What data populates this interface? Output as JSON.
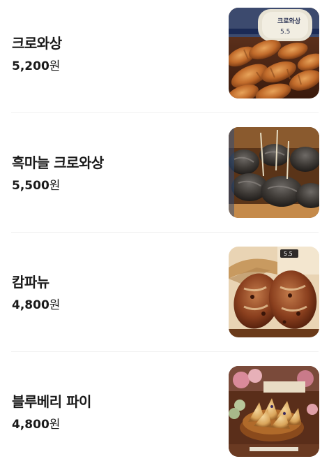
{
  "menu": {
    "items": [
      {
        "name": "크로와상",
        "price": "5,200",
        "unit": "원",
        "image": "croissant-photo"
      },
      {
        "name": "흑마늘 크로와상",
        "price": "5,500",
        "unit": "원",
        "image": "black-garlic-croissant-photo"
      },
      {
        "name": "캄파뉴",
        "price": "4,800",
        "unit": "원",
        "image": "campagne-bread-photo"
      },
      {
        "name": "블루베리 파이",
        "price": "4,800",
        "unit": "원",
        "image": "blueberry-pie-photo"
      }
    ]
  },
  "images": {
    "croissant_sign": "크로와상",
    "croissant_sign_price": "5.5",
    "campagne_tag": "5.5"
  },
  "colors": {
    "text": "#1a1a1a",
    "divider": "#f0f0f0"
  }
}
